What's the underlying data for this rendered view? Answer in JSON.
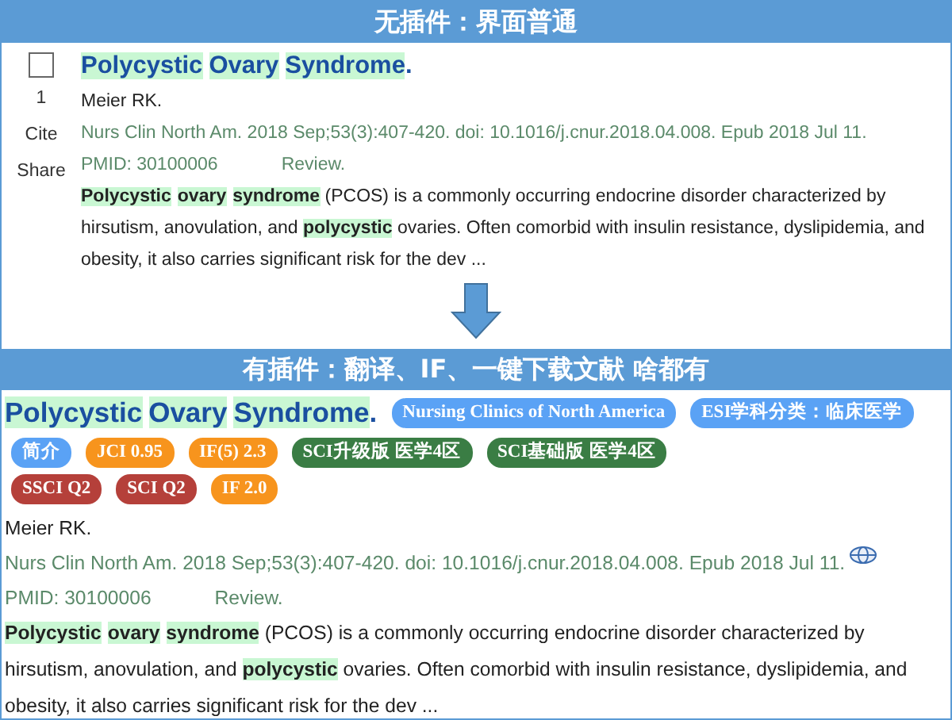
{
  "without_plugin": {
    "header": "无插件：界面普通",
    "result": {
      "checked": false,
      "index": "1",
      "actions": [
        "Cite",
        "Share"
      ],
      "title": [
        {
          "text": "Polycystic",
          "highlight": true
        },
        {
          "text": "Ovary",
          "highlight": true
        },
        {
          "text": "Syndrome",
          "highlight": true
        },
        {
          "text": ".",
          "highlight": false
        }
      ],
      "authors": "Meier RK.",
      "citation": "Nurs Clin North Am. 2018 Sep;53(3):407-420. doi: 10.1016/j.cnur.2018.04.008. Epub 2018 Jul 11.",
      "pmid": "PMID: 30100006",
      "type": "Review.",
      "abstract_lines": [
        [
          {
            "text": "Polycystic",
            "highlight": true
          },
          {
            "text": "ovary",
            "highlight": true
          },
          {
            "text": "syndrome",
            "highlight": true
          },
          {
            "text": " (PCOS) is a commonly occurring endocrine disorder characterized by",
            "highlight": false
          }
        ],
        [
          {
            "text": "hirsutism, anovulation, and ",
            "highlight": false
          },
          {
            "text": "polycystic",
            "highlight": true
          },
          {
            "text": " ovaries. Often comorbid with insulin resistance, dyslipidemia, and",
            "highlight": false
          }
        ],
        [
          {
            "text": "obesity, it also carries significant risk for the dev ...",
            "highlight": false
          }
        ]
      ]
    }
  },
  "with_plugin": {
    "header": "有插件：翻译、IF、一键下载文献 啥都有",
    "result": {
      "title": [
        {
          "text": "Polycystic",
          "highlight": true
        },
        {
          "text": "Ovary",
          "highlight": true
        },
        {
          "text": "Syndrome",
          "highlight": true
        },
        {
          "text": ".",
          "highlight": false
        }
      ],
      "badge_rows": [
        [
          {
            "text": "Nursing Clinics of North America",
            "color": "#5aa2f5"
          },
          {
            "text": "ESI学科分类：临床医学",
            "color": "#5aa2f5"
          }
        ],
        [
          {
            "text": "简介",
            "color": "#5aa2f5"
          },
          {
            "text": "JCI 0.95",
            "color": "#f7941d"
          },
          {
            "text": "IF(5) 2.3",
            "color": "#f7941d"
          },
          {
            "text": "SCI升级版 医学4区",
            "color": "#3a7d44"
          },
          {
            "text": "SCI基础版 医学4区",
            "color": "#3a7d44"
          }
        ],
        [
          {
            "text": "SSCI Q2",
            "color": "#b5403a"
          },
          {
            "text": "SCI Q2",
            "color": "#b5403a"
          },
          {
            "text": "IF 2.0",
            "color": "#f7941d"
          }
        ]
      ],
      "authors": "Meier RK.",
      "citation": "Nurs Clin North Am. 2018 Sep;53(3):407-420. doi: 10.1016/j.cnur.2018.04.008. Epub 2018 Jul 11.",
      "pmid": "PMID: 30100006",
      "type": "Review.",
      "abstract_lines": [
        [
          {
            "text": "Polycystic",
            "highlight": true
          },
          {
            "text": "ovary",
            "highlight": true
          },
          {
            "text": "syndrome",
            "highlight": true
          },
          {
            "text": " (PCOS) is a commonly occurring endocrine disorder characterized by",
            "highlight": false
          }
        ],
        [
          {
            "text": "hirsutism, anovulation, and ",
            "highlight": false
          },
          {
            "text": "polycystic",
            "highlight": true
          },
          {
            "text": " ovaries. Often comorbid with insulin resistance, dyslipidemia, and",
            "highlight": false
          }
        ],
        [
          {
            "text": "obesity, it also carries significant risk for the dev ...",
            "highlight": false
          }
        ]
      ]
    }
  }
}
